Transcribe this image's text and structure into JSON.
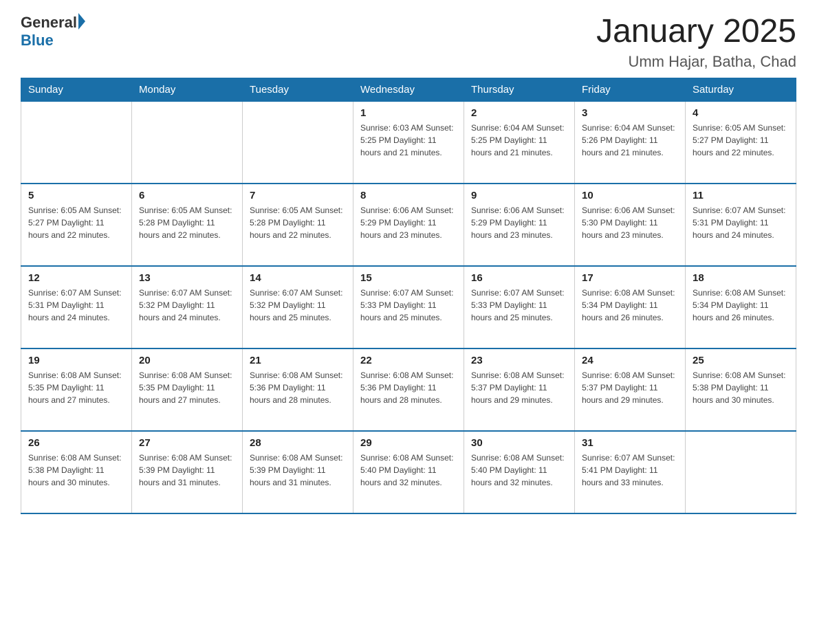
{
  "logo": {
    "general": "General",
    "blue": "Blue"
  },
  "title": "January 2025",
  "location": "Umm Hajar, Batha, Chad",
  "days_of_week": [
    "Sunday",
    "Monday",
    "Tuesday",
    "Wednesday",
    "Thursday",
    "Friday",
    "Saturday"
  ],
  "weeks": [
    [
      {
        "day": "",
        "info": ""
      },
      {
        "day": "",
        "info": ""
      },
      {
        "day": "",
        "info": ""
      },
      {
        "day": "1",
        "info": "Sunrise: 6:03 AM\nSunset: 5:25 PM\nDaylight: 11 hours and 21 minutes."
      },
      {
        "day": "2",
        "info": "Sunrise: 6:04 AM\nSunset: 5:25 PM\nDaylight: 11 hours and 21 minutes."
      },
      {
        "day": "3",
        "info": "Sunrise: 6:04 AM\nSunset: 5:26 PM\nDaylight: 11 hours and 21 minutes."
      },
      {
        "day": "4",
        "info": "Sunrise: 6:05 AM\nSunset: 5:27 PM\nDaylight: 11 hours and 22 minutes."
      }
    ],
    [
      {
        "day": "5",
        "info": "Sunrise: 6:05 AM\nSunset: 5:27 PM\nDaylight: 11 hours and 22 minutes."
      },
      {
        "day": "6",
        "info": "Sunrise: 6:05 AM\nSunset: 5:28 PM\nDaylight: 11 hours and 22 minutes."
      },
      {
        "day": "7",
        "info": "Sunrise: 6:05 AM\nSunset: 5:28 PM\nDaylight: 11 hours and 22 minutes."
      },
      {
        "day": "8",
        "info": "Sunrise: 6:06 AM\nSunset: 5:29 PM\nDaylight: 11 hours and 23 minutes."
      },
      {
        "day": "9",
        "info": "Sunrise: 6:06 AM\nSunset: 5:29 PM\nDaylight: 11 hours and 23 minutes."
      },
      {
        "day": "10",
        "info": "Sunrise: 6:06 AM\nSunset: 5:30 PM\nDaylight: 11 hours and 23 minutes."
      },
      {
        "day": "11",
        "info": "Sunrise: 6:07 AM\nSunset: 5:31 PM\nDaylight: 11 hours and 24 minutes."
      }
    ],
    [
      {
        "day": "12",
        "info": "Sunrise: 6:07 AM\nSunset: 5:31 PM\nDaylight: 11 hours and 24 minutes."
      },
      {
        "day": "13",
        "info": "Sunrise: 6:07 AM\nSunset: 5:32 PM\nDaylight: 11 hours and 24 minutes."
      },
      {
        "day": "14",
        "info": "Sunrise: 6:07 AM\nSunset: 5:32 PM\nDaylight: 11 hours and 25 minutes."
      },
      {
        "day": "15",
        "info": "Sunrise: 6:07 AM\nSunset: 5:33 PM\nDaylight: 11 hours and 25 minutes."
      },
      {
        "day": "16",
        "info": "Sunrise: 6:07 AM\nSunset: 5:33 PM\nDaylight: 11 hours and 25 minutes."
      },
      {
        "day": "17",
        "info": "Sunrise: 6:08 AM\nSunset: 5:34 PM\nDaylight: 11 hours and 26 minutes."
      },
      {
        "day": "18",
        "info": "Sunrise: 6:08 AM\nSunset: 5:34 PM\nDaylight: 11 hours and 26 minutes."
      }
    ],
    [
      {
        "day": "19",
        "info": "Sunrise: 6:08 AM\nSunset: 5:35 PM\nDaylight: 11 hours and 27 minutes."
      },
      {
        "day": "20",
        "info": "Sunrise: 6:08 AM\nSunset: 5:35 PM\nDaylight: 11 hours and 27 minutes."
      },
      {
        "day": "21",
        "info": "Sunrise: 6:08 AM\nSunset: 5:36 PM\nDaylight: 11 hours and 28 minutes."
      },
      {
        "day": "22",
        "info": "Sunrise: 6:08 AM\nSunset: 5:36 PM\nDaylight: 11 hours and 28 minutes."
      },
      {
        "day": "23",
        "info": "Sunrise: 6:08 AM\nSunset: 5:37 PM\nDaylight: 11 hours and 29 minutes."
      },
      {
        "day": "24",
        "info": "Sunrise: 6:08 AM\nSunset: 5:37 PM\nDaylight: 11 hours and 29 minutes."
      },
      {
        "day": "25",
        "info": "Sunrise: 6:08 AM\nSunset: 5:38 PM\nDaylight: 11 hours and 30 minutes."
      }
    ],
    [
      {
        "day": "26",
        "info": "Sunrise: 6:08 AM\nSunset: 5:38 PM\nDaylight: 11 hours and 30 minutes."
      },
      {
        "day": "27",
        "info": "Sunrise: 6:08 AM\nSunset: 5:39 PM\nDaylight: 11 hours and 31 minutes."
      },
      {
        "day": "28",
        "info": "Sunrise: 6:08 AM\nSunset: 5:39 PM\nDaylight: 11 hours and 31 minutes."
      },
      {
        "day": "29",
        "info": "Sunrise: 6:08 AM\nSunset: 5:40 PM\nDaylight: 11 hours and 32 minutes."
      },
      {
        "day": "30",
        "info": "Sunrise: 6:08 AM\nSunset: 5:40 PM\nDaylight: 11 hours and 32 minutes."
      },
      {
        "day": "31",
        "info": "Sunrise: 6:07 AM\nSunset: 5:41 PM\nDaylight: 11 hours and 33 minutes."
      },
      {
        "day": "",
        "info": ""
      }
    ]
  ]
}
